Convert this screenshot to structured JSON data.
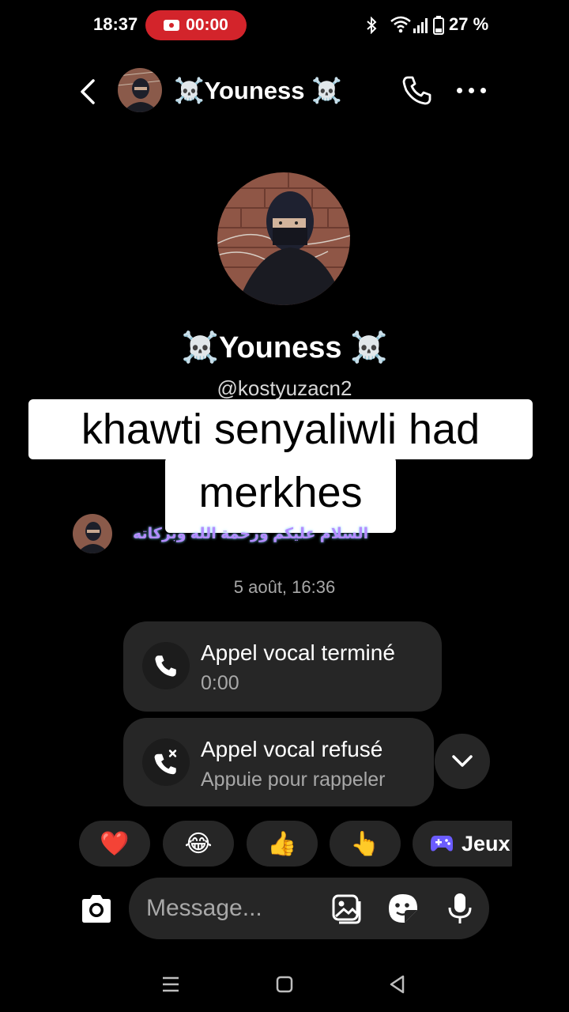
{
  "status_bar": {
    "time": "18:37",
    "recording_time": "00:00",
    "battery": "27 %"
  },
  "header": {
    "contact_name": "☠️Youness ☠️",
    "icons": [
      "back-arrow-icon",
      "phone-icon",
      "more-dots-icon"
    ]
  },
  "profile": {
    "name": "☠️Youness ☠️",
    "username": "@kostyuzacn2"
  },
  "caption": {
    "line1": "khawti senyaliwli had",
    "line2": "merkhes"
  },
  "messages": {
    "incoming_text": "السلام عليكم ورحمة الله وبركاته",
    "date_divider": "5 août, 16:36",
    "calls": [
      {
        "title": "Appel vocal terminé",
        "subtitle": "0:00",
        "icon": "phone-icon"
      },
      {
        "title": "Appel vocal refusé",
        "subtitle": "Appuie pour rappeler",
        "icon": "missed-call-icon"
      }
    ]
  },
  "quick_reactions": {
    "items": [
      "❤️",
      "😂",
      "👍",
      "👆"
    ],
    "games_label": "Jeux"
  },
  "composer": {
    "placeholder": "Message..."
  },
  "colors": {
    "background": "#000000",
    "bubble": "#262626",
    "recording_red": "#d3242b",
    "secondary_text": "#a8a8a8"
  }
}
